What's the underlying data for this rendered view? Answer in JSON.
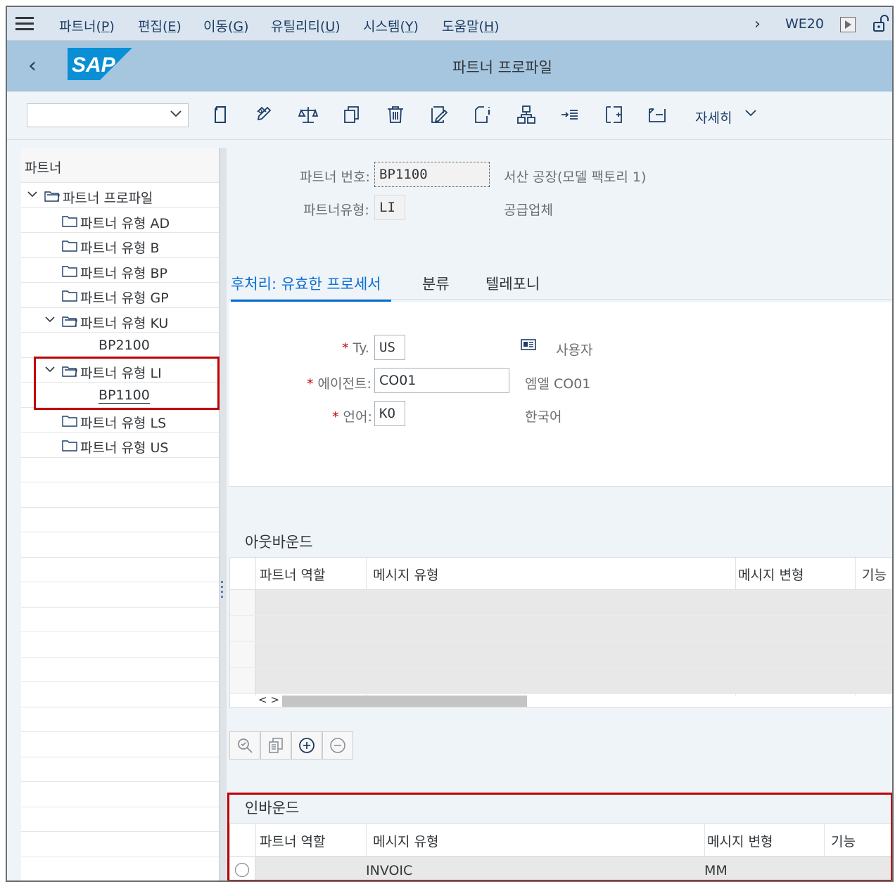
{
  "menubar": {
    "items": [
      {
        "pre": "파트너(",
        "key": "P",
        "post": ")"
      },
      {
        "pre": "편집(",
        "key": "E",
        "post": ")"
      },
      {
        "pre": "이동(",
        "key": "G",
        "post": ")"
      },
      {
        "pre": "유틸리티(",
        "key": "U",
        "post": ")"
      },
      {
        "pre": "시스템(",
        "key": "Y",
        "post": ")"
      },
      {
        "pre": "도움말(",
        "key": "H",
        "post": ")"
      }
    ],
    "tcode": "WE20"
  },
  "header": {
    "title": "파트너 프로파일",
    "logo_text": "SAP"
  },
  "toolbar": {
    "more_label": "자세히",
    "icons": [
      "new-icon",
      "edit-icon",
      "compare-icon",
      "copy-icon",
      "delete-icon",
      "change-icon",
      "info-icon",
      "hierarchy-icon",
      "forward-list-icon",
      "add-entry-icon",
      "inbox-icon"
    ]
  },
  "tree": {
    "header": "파트너",
    "root": "파트너 프로파일",
    "items": {
      "ad": "파트너 유형 AD",
      "b": "파트너 유형 B",
      "bp": "파트너 유형 BP",
      "gp": "파트너 유형 GP",
      "ku": "파트너 유형 KU",
      "ku_child": "BP2100",
      "li": "파트너 유형 LI",
      "li_child": "BP1100",
      "ls": "파트너 유형 LS",
      "us": "파트너 유형 US"
    }
  },
  "partner": {
    "number_label": "파트너 번호:",
    "number_value": "BP1100",
    "number_desc": "서산 공장(모델 팩토리 1)",
    "type_label": "파트너유형:",
    "type_value": "LI",
    "type_desc": "공급업체"
  },
  "tabs": {
    "t1": "후처리: 유효한 프로세서",
    "t2": "분류",
    "t3": "텔레포니"
  },
  "processor": {
    "ty_label": "Ty.",
    "ty_value": "US",
    "ty_desc": "사용자",
    "agent_label": "에이전트:",
    "agent_value": "CO01",
    "agent_desc": "엠엘 CO01",
    "lang_label": "언어:",
    "lang_value": "KO",
    "lang_desc": "한국어",
    "required_mark": "*"
  },
  "outbound": {
    "title": "아웃바운드",
    "columns": [
      "파트너 역할",
      "메시지 유형",
      "메시지 변형",
      "기능"
    ],
    "scroll_arrows": "< >"
  },
  "inbound": {
    "title": "인바운드",
    "columns": [
      "파트너 역할",
      "메시지 유형",
      "메시지 변형",
      "기능"
    ],
    "rows": [
      {
        "role": "",
        "message_type": "INVOIC",
        "variant": "MM",
        "function": ""
      }
    ]
  }
}
